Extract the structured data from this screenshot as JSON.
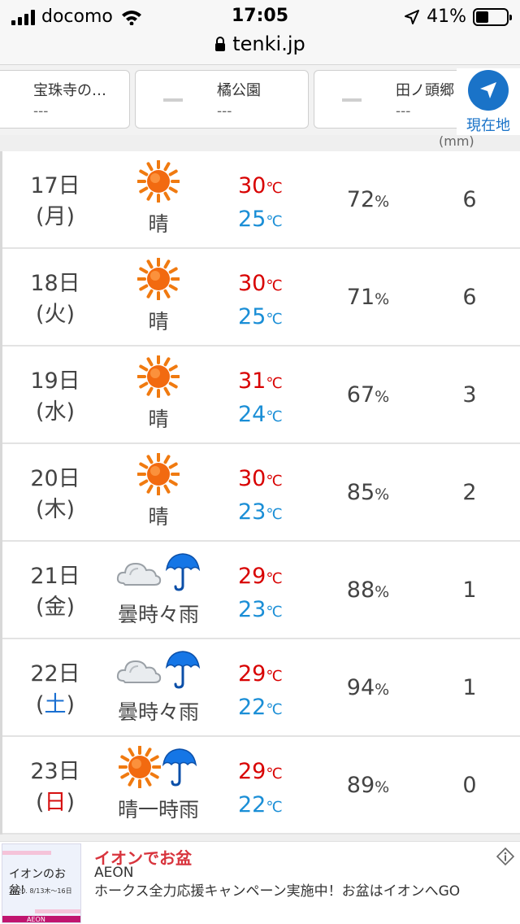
{
  "status_bar": {
    "carrier": "docomo",
    "time": "17:05",
    "battery": "41%",
    "battery_level": 0.41
  },
  "browser": {
    "url": "tenki.jp"
  },
  "locations": [
    {
      "name": "宝珠寺の…",
      "value": "---"
    },
    {
      "name": "橘公園",
      "value": "---"
    },
    {
      "name": "田ノ頭郷",
      "value": "---"
    }
  ],
  "current_location": {
    "label": "現在地"
  },
  "header_peek": "(mm)",
  "forecast": [
    {
      "date": "17日",
      "dow": "(月)",
      "weather": "晴",
      "icons": [
        "sun"
      ],
      "high": "30",
      "low": "25",
      "humidity": "72",
      "precip": "6"
    },
    {
      "date": "18日",
      "dow": "(火)",
      "weather": "晴",
      "icons": [
        "sun"
      ],
      "high": "30",
      "low": "25",
      "humidity": "71",
      "precip": "6"
    },
    {
      "date": "19日",
      "dow": "(水)",
      "weather": "晴",
      "icons": [
        "sun"
      ],
      "high": "31",
      "low": "24",
      "humidity": "67",
      "precip": "3"
    },
    {
      "date": "20日",
      "dow": "(木)",
      "weather": "晴",
      "icons": [
        "sun"
      ],
      "high": "30",
      "low": "23",
      "humidity": "85",
      "precip": "2"
    },
    {
      "date": "21日",
      "dow": "(金)",
      "weather": "曇時々雨",
      "icons": [
        "cloud",
        "umbrella"
      ],
      "high": "29",
      "low": "23",
      "humidity": "88",
      "precip": "1"
    },
    {
      "date": "22日",
      "dow_open": "(",
      "dow_char": "土",
      "dow_close": ")",
      "dow_type": "sat",
      "weather": "曇時々雨",
      "icons": [
        "cloud",
        "umbrella"
      ],
      "high": "29",
      "low": "22",
      "humidity": "94",
      "precip": "1"
    },
    {
      "date": "23日",
      "dow_open": "(",
      "dow_char": "日",
      "dow_close": ")",
      "dow_type": "sun",
      "weather": "晴一時雨",
      "icons": [
        "sun",
        "umbrella"
      ],
      "high": "29",
      "low": "22",
      "humidity": "89",
      "precip": "0"
    }
  ],
  "units": {
    "temp": "℃",
    "humidity": "%"
  },
  "ad": {
    "title": "イオンでお盆",
    "sponsor": "AEON",
    "text": "ホークス全力応援キャンペーン実施中！お盆はイオンへGO",
    "thumb_title": "イオンのお盆!",
    "thumb_date": "2020. 8/13木〜16日",
    "thumb_brand": "AEON"
  },
  "colors": {
    "high": "#d80000",
    "low": "#1a8ed6",
    "accent": "#1a73c8",
    "saturday": "#1a6fd1",
    "sunday": "#d60f0f"
  }
}
